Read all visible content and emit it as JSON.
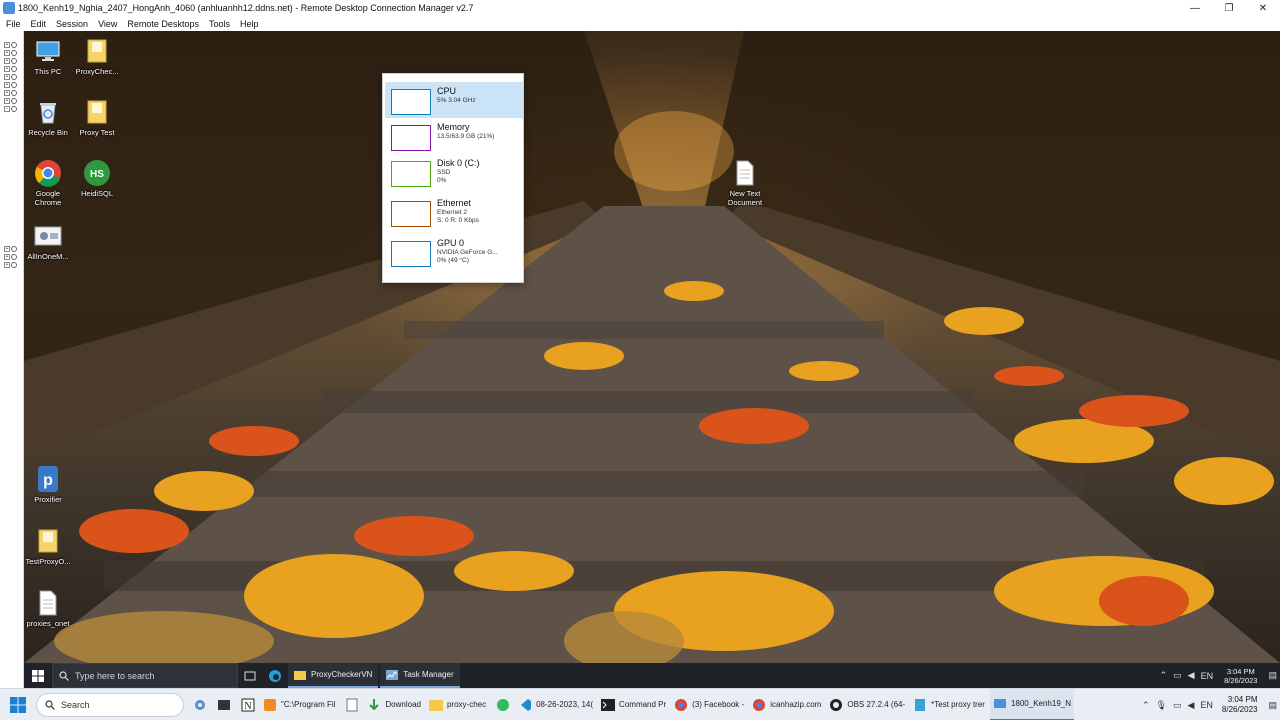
{
  "window": {
    "title": "1800_Kenh19_Nghia_2407_HongAnh_4060 (anhluanhh12.ddns.net) - Remote Desktop Connection Manager v2.7",
    "controls": [
      "—",
      "❐",
      "✕"
    ]
  },
  "menu": [
    "File",
    "Edit",
    "Session",
    "View",
    "Remote Desktops",
    "Tools",
    "Help"
  ],
  "desktop_icons": [
    {
      "label": "This PC",
      "icon": "monitor-icon"
    },
    {
      "label": "ProxyChec...",
      "icon": "folder-icon"
    },
    {
      "label": "Recycle Bin",
      "icon": "recycle-bin-icon"
    },
    {
      "label": "Proxy Test",
      "icon": "folder-icon"
    },
    {
      "label": "Google Chrome",
      "icon": "chrome-icon"
    },
    {
      "label": "HeidiSQL",
      "icon": "heidisql-icon"
    },
    {
      "label": "AllInOneM...",
      "icon": "app-icon"
    },
    {
      "label": "New Text Document",
      "icon": "text-file-icon"
    },
    {
      "label": "Proxifier",
      "icon": "proxifier-icon"
    },
    {
      "label": "TestProxyO...",
      "icon": "folder-icon"
    },
    {
      "label": "proxies_onet",
      "icon": "text-file-icon"
    }
  ],
  "task_manager": {
    "items": [
      {
        "name": "CPU",
        "sub1": "5% 3.04 GHz",
        "sub2": "",
        "sub3": "",
        "color": "#117dbb"
      },
      {
        "name": "Memory",
        "sub1": "13.5/63.9 GB (21%)",
        "sub2": "",
        "sub3": "",
        "color": "#8b12ae"
      },
      {
        "name": "Disk 0 (C:)",
        "sub1": "SSD",
        "sub2": "0%",
        "sub3": "",
        "color": "#4da60c"
      },
      {
        "name": "Ethernet",
        "sub1": "Ethernet 2",
        "sub2": "S: 0 R: 0 Kbps",
        "sub3": "",
        "color": "#a74f01"
      },
      {
        "name": "GPU 0",
        "sub1": "NVIDIA GeForce G...",
        "sub2": "0% (49 °C)",
        "sub3": "",
        "color": "#117dbb"
      }
    ]
  },
  "remote_taskbar": {
    "search_placeholder": "Type here to search",
    "apps": [
      "ProxyCheckerVN",
      "Task Manager"
    ],
    "time": "3:04 PM",
    "date": "8/26/2023"
  },
  "host_taskbar": {
    "search_placeholder": "Search",
    "apps": [
      "\"C:\\Program Fil",
      "Download",
      "proxy-chec",
      "08-26-2023, 14(",
      "Command Pr",
      "(3) Facebook -",
      "icanhazip.com",
      "OBS 27.2.4 (64-",
      "*Test proxy trer",
      "1800_Kenh19_N"
    ],
    "time": "3:04 PM",
    "date": "8/26/2023"
  }
}
